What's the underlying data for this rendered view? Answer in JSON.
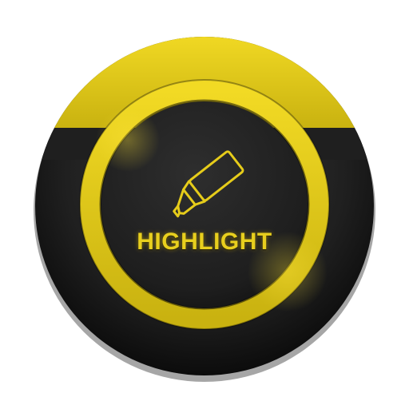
{
  "button": {
    "label": "HIGHLIGHT",
    "icon": "highlighter-marker-icon"
  },
  "colors": {
    "accent": "#e6cc1a",
    "accent_dark": "#9a8a0e",
    "body_dark": "#1c1c1c",
    "body_mid": "#2b2b2b",
    "background": "#ffffff"
  }
}
